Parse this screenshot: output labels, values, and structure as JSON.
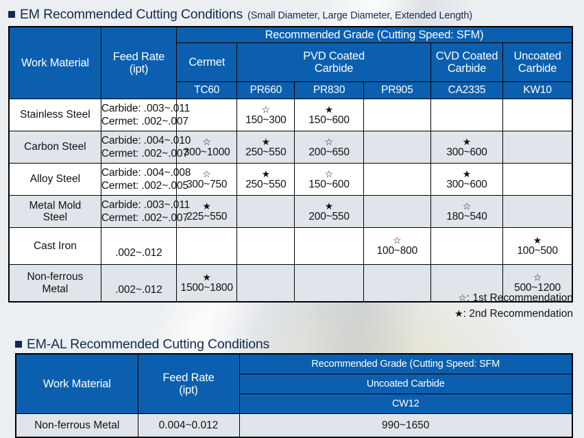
{
  "section1": {
    "title_main": "EM Recommended Cutting Conditions",
    "title_sub": "(Small Diameter, Large Diameter, Extended Length)",
    "headers": {
      "work_material": "Work Material",
      "feed_rate": "Feed Rate",
      "feed_rate_unit": "(ipt)",
      "recommended_grade": "Recommended Grade (Cutting Speed: SFM)",
      "categories": [
        {
          "label": "Cermet",
          "grades": [
            "TC60"
          ]
        },
        {
          "label": "PVD Coated\nCarbide",
          "label_line1": "PVD Coated",
          "label_line2": "Carbide",
          "grades": [
            "PR660",
            "PR830",
            "PR905"
          ]
        },
        {
          "label_line1": "CVD Coated",
          "label_line2": "Carbide",
          "grades": [
            "CA2335"
          ]
        },
        {
          "label_line1": "Uncoated",
          "label_line2": "Carbide",
          "grades": [
            "KW10"
          ]
        }
      ],
      "grade_row": [
        "TC60",
        "PR660",
        "PR830",
        "PR905",
        "CA2335",
        "KW10"
      ]
    },
    "rows": [
      {
        "material": "Stainless Steel",
        "feed_lines": [
          "Carbide: .003~.011",
          "Cermet: .002~.007"
        ],
        "cells": [
          {
            "star": "",
            "value": ""
          },
          {
            "star": "☆",
            "value": "150~300"
          },
          {
            "star": "★",
            "value": "150~600"
          },
          {
            "star": "",
            "value": ""
          },
          {
            "star": "",
            "value": ""
          },
          {
            "star": "",
            "value": ""
          }
        ]
      },
      {
        "material": "Carbon Steel",
        "feed_lines": [
          "Carbide: .004~.010",
          "Cermet: .002~.007"
        ],
        "cells": [
          {
            "star": "☆",
            "value": "300~1000"
          },
          {
            "star": "★",
            "value": "250~550"
          },
          {
            "star": "☆",
            "value": "200~650"
          },
          {
            "star": "",
            "value": ""
          },
          {
            "star": "★",
            "value": "300~600"
          },
          {
            "star": "",
            "value": ""
          }
        ]
      },
      {
        "material": "Alloy Steel",
        "feed_lines": [
          "Carbide: .004~.008",
          "Cermet: .002~.005"
        ],
        "cells": [
          {
            "star": "☆",
            "value": "300~750"
          },
          {
            "star": "★",
            "value": "250~550"
          },
          {
            "star": "☆",
            "value": "150~600"
          },
          {
            "star": "",
            "value": ""
          },
          {
            "star": "★",
            "value": "300~600"
          },
          {
            "star": "",
            "value": ""
          }
        ]
      },
      {
        "material_line1": "Metal Mold",
        "material_line2": "Steel",
        "feed_lines": [
          "Carbide: .003~.011",
          "Cermet: .002~.007"
        ],
        "cells": [
          {
            "star": "★",
            "value": "225~550"
          },
          {
            "star": "",
            "value": ""
          },
          {
            "star": "★",
            "value": "200~550"
          },
          {
            "star": "",
            "value": ""
          },
          {
            "star": "☆",
            "value": "180~540"
          },
          {
            "star": "",
            "value": ""
          }
        ]
      },
      {
        "material": "Cast Iron",
        "feed_plain": ".002~.012",
        "cells": [
          {
            "star": "",
            "value": ""
          },
          {
            "star": "",
            "value": ""
          },
          {
            "star": "",
            "value": ""
          },
          {
            "star": "☆",
            "value": "100~800"
          },
          {
            "star": "",
            "value": ""
          },
          {
            "star": "★",
            "value": "100~500"
          }
        ]
      },
      {
        "material_line1": "Non-ferrous",
        "material_line2": "Metal",
        "feed_plain": ".002~.012",
        "cells": [
          {
            "star": "★",
            "value": "1500~1800"
          },
          {
            "star": "",
            "value": ""
          },
          {
            "star": "",
            "value": ""
          },
          {
            "star": "",
            "value": ""
          },
          {
            "star": "",
            "value": ""
          },
          {
            "star": "☆",
            "value": "500~1200"
          }
        ]
      }
    ],
    "legend": [
      {
        "symbol": "☆",
        "text": ": 1st Recommendation"
      },
      {
        "symbol": "★",
        "text": ": 2nd Recommendation"
      }
    ]
  },
  "section2": {
    "title_main": "EM-AL Recommended Cutting Conditions",
    "headers": {
      "work_material": "Work Material",
      "feed_rate": "Feed Rate",
      "feed_rate_unit": "(ipt)",
      "recommended_grade": "Recommended Grade (Cutting Speed: SFM",
      "category": "Uncoated Carbide",
      "grade": "CW12"
    },
    "row": {
      "material": "Non-ferrous Metal",
      "feed": "0.004~0.012",
      "value": "990~1650"
    }
  },
  "colors": {
    "header_blue": "#0b5fae",
    "title_navy": "#14294d",
    "row_alt": "#dfe5ea",
    "row_base": "#ffffff",
    "page_bg": "#eceff1",
    "border": "#000000"
  }
}
